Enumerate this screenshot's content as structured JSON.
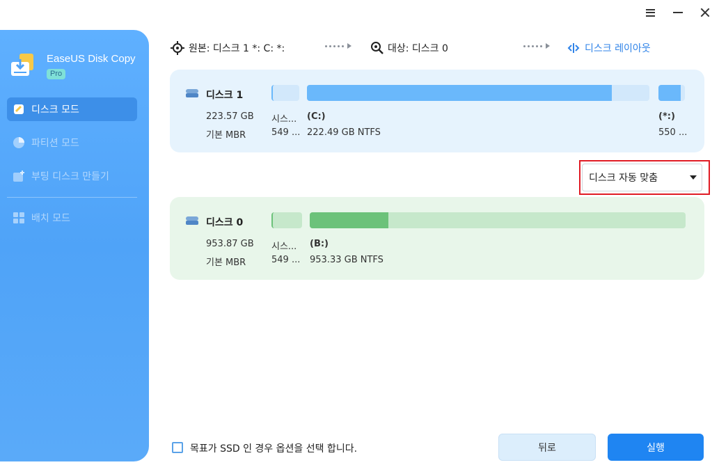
{
  "window_controls": {
    "menu": "menu-icon",
    "minimize": "minimize-icon",
    "close": "close-icon"
  },
  "sidebar": {
    "app_name": "EaseUS Disk Copy",
    "badge": "Pro",
    "items": [
      {
        "label": "디스크 모드",
        "icon": "disk-mode-icon",
        "active": true
      },
      {
        "label": "파티션 모드",
        "icon": "partition-mode-icon",
        "active": false
      },
      {
        "label": "부팅 디스크 만들기",
        "icon": "bootable-disk-icon",
        "active": false
      },
      {
        "label": "배치 모드",
        "icon": "batch-mode-icon",
        "active": false
      }
    ]
  },
  "path": {
    "source": "원본: 디스크 1 *: C: *:",
    "target": "대상: 디스크 0",
    "layout": "디스크 레이아웃"
  },
  "source_disk": {
    "name": "디스크 1",
    "size": "223.57 GB",
    "type": "기본 MBR",
    "partitions": [
      {
        "label": "시스...",
        "detail": "549 ..."
      },
      {
        "label": "(C:)",
        "detail": "222.49 GB NTFS",
        "used_fraction": 0.89
      },
      {
        "label": "(*:)",
        "detail": "550 ..."
      }
    ]
  },
  "layout_dropdown": {
    "selected": "디스크 자동 맞춤"
  },
  "target_disk": {
    "name": "디스크 0",
    "size": "953.87 GB",
    "type": "기본 MBR",
    "partitions": [
      {
        "label": "시스...",
        "detail": "549 ..."
      },
      {
        "label": "(B:)",
        "detail": "953.33 GB NTFS",
        "used_fraction": 0.21
      }
    ]
  },
  "footer": {
    "ssd_option": "목표가 SSD 인 경우 옵션을 선택 합니다.",
    "back": "뒤로",
    "run": "실행"
  },
  "colors": {
    "sidebar": "#4fa3f8",
    "accent": "#1f85f2",
    "source_bar": "#6ab8fb",
    "target_bar": "#6cc27a",
    "highlight": "#e01b24"
  }
}
